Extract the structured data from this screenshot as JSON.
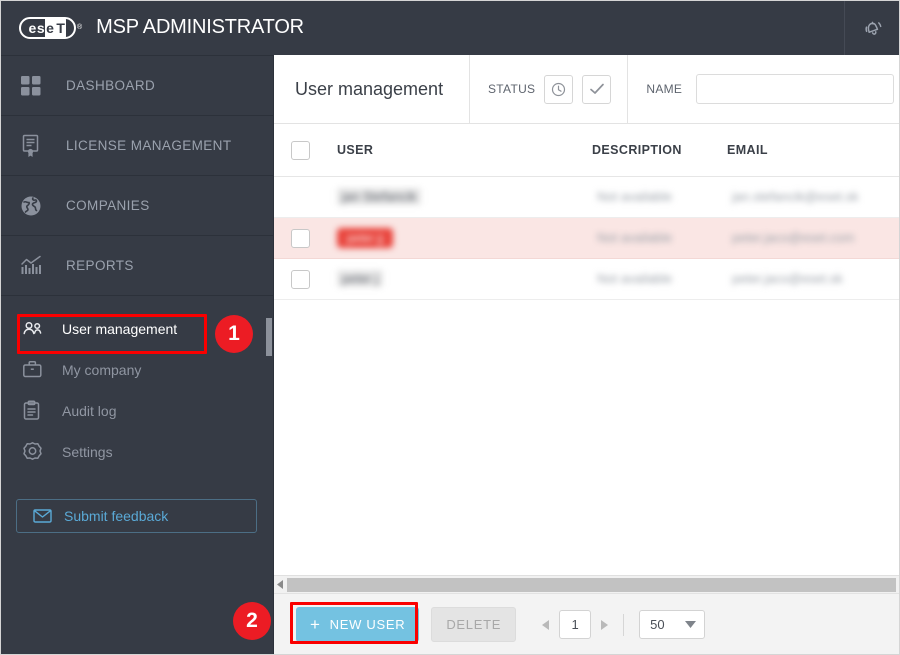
{
  "topbar": {
    "logo_text_left": "es",
    "logo_text_mid": "e",
    "logo_text_right": "T",
    "logo_tm": "®",
    "app_title": "MSP ADMINISTRATOR",
    "bell_icon": "notification-bell-icon"
  },
  "sidebar": {
    "main_items": [
      {
        "label": "DASHBOARD",
        "icon": "grid-icon"
      },
      {
        "label": "LICENSE MANAGEMENT",
        "icon": "certificate-icon"
      },
      {
        "label": "COMPANIES",
        "icon": "globe-icon"
      },
      {
        "label": "REPORTS",
        "icon": "chart-icon"
      }
    ],
    "sub_items": [
      {
        "label": "User management",
        "icon": "users-icon",
        "active": true
      },
      {
        "label": "My company",
        "icon": "briefcase-icon",
        "active": false
      },
      {
        "label": "Audit log",
        "icon": "clipboard-icon",
        "active": false
      },
      {
        "label": "Settings",
        "icon": "gear-icon",
        "active": false
      }
    ],
    "feedback": {
      "label": "Submit feedback",
      "icon": "envelope-icon"
    }
  },
  "header": {
    "title": "User management",
    "status_label": "STATUS",
    "status_buttons": [
      {
        "icon": "clock-icon"
      },
      {
        "icon": "check-icon"
      }
    ],
    "name_label": "NAME",
    "name_value": "",
    "name_placeholder": ""
  },
  "table": {
    "columns": [
      "USER",
      "DESCRIPTION",
      "EMAIL"
    ],
    "rows": [
      {
        "checkbox": false,
        "has_checkbox": false,
        "user": "jan Stefancik",
        "user_style": "redacted",
        "description": "Not available",
        "email": "jan.stefancik@eset.sk",
        "highlight": false
      },
      {
        "checkbox": false,
        "has_checkbox": true,
        "user": "peter jj",
        "user_style": "badge",
        "description": "Not available",
        "email": "peter.jaco@eset.com",
        "highlight": true
      },
      {
        "checkbox": false,
        "has_checkbox": true,
        "user": "peter j",
        "user_style": "redacted",
        "description": "Not available",
        "email": "peter.jaco@eset.sk",
        "highlight": false
      }
    ]
  },
  "bottombar": {
    "new_user_label": "NEW USER",
    "new_user_plus": "+",
    "delete_label": "DELETE",
    "page_value": "1",
    "page_size_value": "50"
  },
  "annotations": [
    {
      "number": "1",
      "target": "user-management-nav-item"
    },
    {
      "number": "2",
      "target": "new-user-button"
    }
  ],
  "colors": {
    "sidebar_bg": "#363b45",
    "accent_blue": "#74c2e1",
    "link_blue": "#5aa9d6",
    "annotation_red": "#ec1c24",
    "row_highlight": "#fae6e4",
    "badge_red": "#e8423a"
  }
}
